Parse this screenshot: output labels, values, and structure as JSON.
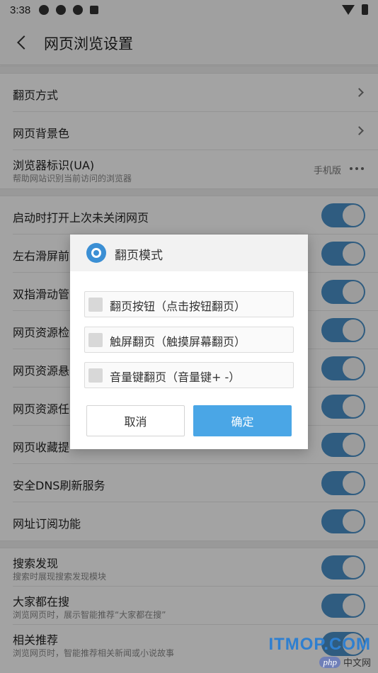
{
  "status_bar": {
    "time": "3:38",
    "icons": [
      "app-icon-1",
      "app-icon-2",
      "app-icon-3",
      "a-icon"
    ],
    "right_icons": [
      "wifi-icon",
      "battery-icon"
    ]
  },
  "app_bar": {
    "title": "网页浏览设置",
    "back_icon": "back-arrow-icon"
  },
  "settings": {
    "group1": [
      {
        "label": "翻页方式",
        "control": "chevron"
      },
      {
        "label": "网页背景色",
        "control": "chevron"
      },
      {
        "label": "浏览器标识(UA)",
        "sub": "帮助网站识别当前访问的浏览器",
        "value": "手机版",
        "control": "more"
      }
    ],
    "group2": [
      {
        "label": "启动时打开上次未关闭网页",
        "on": true
      },
      {
        "label": "左右滑屏前",
        "on": true
      },
      {
        "label": "双指滑动管",
        "on": true
      },
      {
        "label": "网页资源检",
        "on": true
      },
      {
        "label": "网页资源悬",
        "on": true
      },
      {
        "label": "网页资源任",
        "on": true
      },
      {
        "label": "网页收藏提",
        "on": true
      },
      {
        "label": "安全DNS刷新服务",
        "on": true
      },
      {
        "label": "网址订阅功能",
        "on": true
      }
    ],
    "group3": [
      {
        "label": "搜索发现",
        "sub": "搜索时展现搜索发现模块",
        "on": true
      },
      {
        "label": "大家都在搜",
        "sub": "浏览网页时，展示智能推荐“大家都在搜”",
        "on": true
      },
      {
        "label": "相关推荐",
        "sub": "浏览网页时，智能推荐相关新闻或小说故事",
        "on": true
      }
    ]
  },
  "dialog": {
    "title": "翻页模式",
    "options": [
      {
        "label": "翻页按钮（点击按钮翻页）",
        "checked": false
      },
      {
        "label": "触屏翻页（触摸屏幕翻页）",
        "checked": false
      },
      {
        "label": "音量键翻页（音量键+ -）",
        "checked": false
      }
    ],
    "cancel_label": "取消",
    "ok_label": "确定"
  },
  "watermark": {
    "main": "ITMOP.COM",
    "php": "php",
    "cn": "中文网"
  },
  "colors": {
    "switch_on": "#4a90c8",
    "ok_button": "#4aa6e6",
    "gear": "#3b8fd4"
  }
}
